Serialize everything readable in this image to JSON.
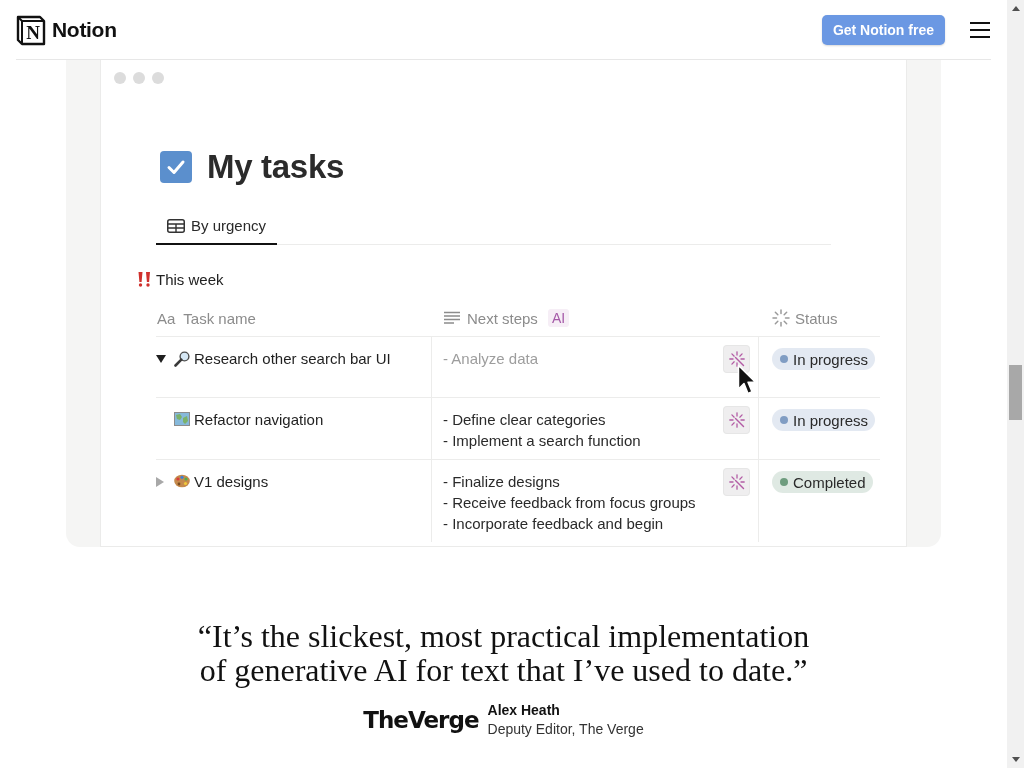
{
  "header": {
    "logo_mark": "N",
    "brand": "Notion",
    "cta": "Get Notion free"
  },
  "demo": {
    "page_title": "My tasks",
    "tabs": [
      {
        "label": "By urgency",
        "selected": true
      }
    ],
    "group": {
      "label": "This week"
    },
    "columns": [
      {
        "kind": "title",
        "glyph": "Aa",
        "label": "Task name"
      },
      {
        "kind": "text",
        "label": "Next steps",
        "badge": "AI"
      },
      {
        "kind": "status",
        "label": "Status"
      }
    ],
    "rows": [
      {
        "collapsible": true,
        "expanded": true,
        "kind": "magnifier",
        "name": "Research other search bar UI",
        "next_steps": [
          "- Analyze data"
        ],
        "muted": true,
        "hovered": true,
        "status": {
          "label": "In progress",
          "color": "#809dc3"
        }
      },
      {
        "collapsible": false,
        "kind": "map",
        "name": "Refactor navigation",
        "next_steps": [
          "- Define clear categories",
          "- Implement a search function"
        ],
        "muted": false,
        "hovered": false,
        "status": {
          "label": "In progress",
          "color": "#809dc3"
        }
      },
      {
        "collapsible": true,
        "expanded": false,
        "kind": "palette",
        "name": "V1 designs",
        "next_steps": [
          "- Finalize designs",
          "- Receive feedback from focus groups",
          "- Incorporate feedback and begin"
        ],
        "muted": false,
        "hovered": false,
        "status": {
          "label": "Completed",
          "color": "#6e9c7e"
        }
      }
    ]
  },
  "quote": {
    "text": "“It’s the slickest, most practical implementation of generative AI for text that I’ve used to date.”",
    "publication": "TheVerge",
    "author": "Alex Heath",
    "role": "Deputy Editor, The Verge"
  }
}
